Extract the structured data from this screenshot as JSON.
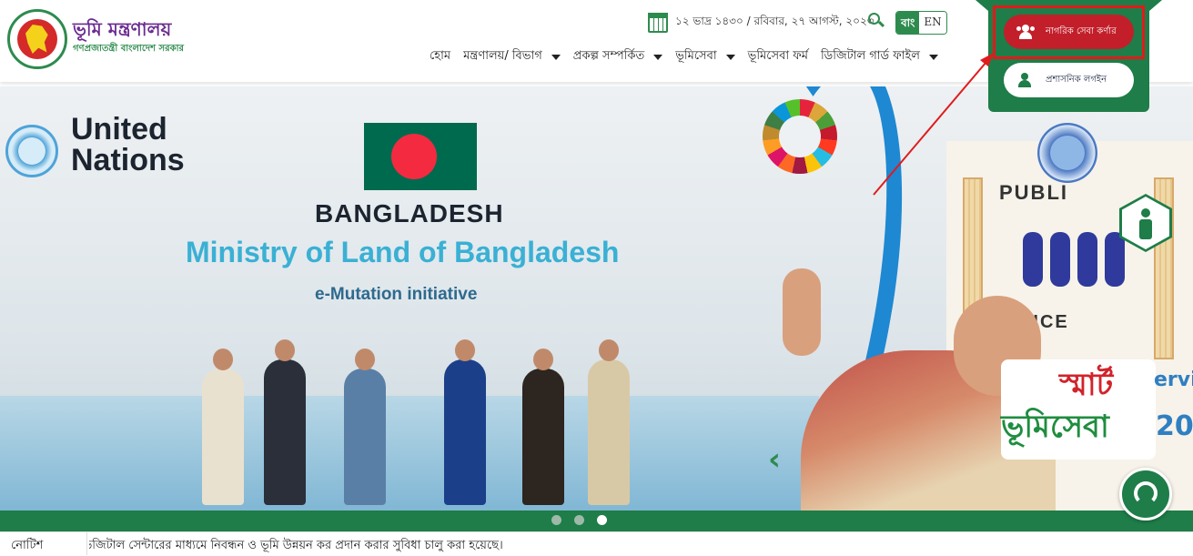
{
  "header": {
    "title": "ভূমি মন্ত্রণালয়",
    "subtitle": "গণপ্রজাতন্ত্রী বাংলাদেশ সরকার",
    "date": "১২ ভাদ্র ১৪৩০ / রবিবার, ২৭ আগস্ট, ২০২৩",
    "lang_bn": "বাং",
    "lang_en": "EN"
  },
  "nav": {
    "items": [
      {
        "label": "হোম",
        "dropdown": false
      },
      {
        "label": "মন্ত্রণালয়/ বিভাগ",
        "dropdown": true
      },
      {
        "label": "প্রকল্প সম্পর্কিত",
        "dropdown": true
      },
      {
        "label": "ভূমিসেবা",
        "dropdown": true
      },
      {
        "label": "ভূমিসেবা ফর্ম",
        "dropdown": false
      },
      {
        "label": "ডিজিটাল গার্ড ফাইল",
        "dropdown": true
      }
    ]
  },
  "dropdown": {
    "citizen_corner": "নাগরিক সেবা কর্ণার",
    "admin_login": "প্রশাসনিক লগইন"
  },
  "banner": {
    "un_line1": "United",
    "un_line2": "Nations",
    "country": "BANGLADESH",
    "ministry": "Ministry of Land of Bangladesh",
    "initiative": "e-Mutation initiative",
    "public": "PUBLI",
    "service": "RVICE",
    "smart1": "স্মার্ট",
    "smart2": "ভূমিসেবা",
    "service_partial": "ervice",
    "year_partial": "20",
    "prev": "‹"
  },
  "carousel": {
    "slides": 3,
    "active_index": 3
  },
  "notice": {
    "label": "নোটিশ",
    "text": "ডিজিটাল সেন্টারের মাধ্যমে নিবন্ধন ও ভূমি উন্নয়ন কর প্রদান করার সুবিধা চালু করা হয়েছে।"
  },
  "colors": {
    "brand_green": "#1e7d48",
    "citizen_red": "#c21f2a",
    "highlight_red": "#e01b1b",
    "title_purple": "#6a2c91"
  }
}
